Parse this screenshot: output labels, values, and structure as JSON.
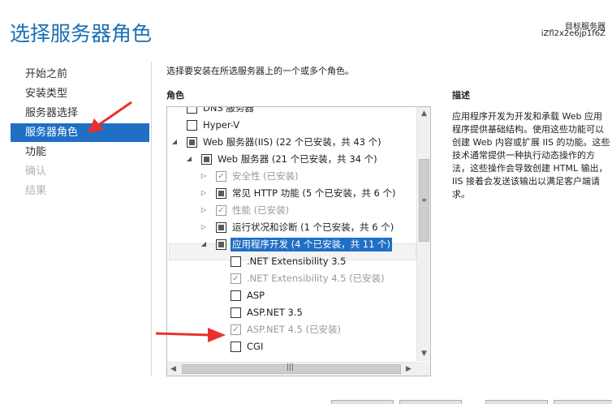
{
  "header": {
    "title": "选择服务器角色",
    "target_label": "目标服务器",
    "target_name": "iZfl2x2e6jp1f6Z"
  },
  "nav": {
    "items": [
      {
        "label": "开始之前",
        "state": "normal"
      },
      {
        "label": "安装类型",
        "state": "normal"
      },
      {
        "label": "服务器选择",
        "state": "normal"
      },
      {
        "label": "服务器角色",
        "state": "active"
      },
      {
        "label": "功能",
        "state": "normal"
      },
      {
        "label": "确认",
        "state": "disabled"
      },
      {
        "label": "结果",
        "state": "disabled"
      }
    ]
  },
  "main": {
    "instruction": "选择要安装在所选服务器上的一个或多个角色。",
    "roles_header": "角色",
    "description_header": "描述",
    "description": "应用程序开发为开发和承载 Web 应用程序提供基础结构。使用这些功能可以创建 Web 内容或扩展 IIS 的功能。这些技术通常提供一种执行动态操作的方法，这些操作会导致创建 HTML 输出，IIS 接着会发送该输出以满足客户端请求。"
  },
  "tree": {
    "rows": [
      {
        "label": "DNS 服务器",
        "state": "unchecked",
        "level": 0,
        "expander": "none"
      },
      {
        "label": "Hyper-V",
        "state": "unchecked",
        "level": 0,
        "expander": "none"
      },
      {
        "label": "Web 服务器(IIS) (22 个已安装，共 43 个)",
        "state": "partial",
        "level": 0,
        "expander": "expanded"
      },
      {
        "label": "Web 服务器 (21 个已安装，共 34 个)",
        "state": "partial",
        "level": 1,
        "expander": "expanded"
      },
      {
        "label": "安全性 (已安装)",
        "state": "checked-grey",
        "level": 2,
        "expander": "collapsed"
      },
      {
        "label": "常见 HTTP 功能 (5 个已安装，共 6 个)",
        "state": "partial",
        "level": 2,
        "expander": "collapsed"
      },
      {
        "label": "性能 (已安装)",
        "state": "checked-grey",
        "level": 2,
        "expander": "collapsed"
      },
      {
        "label": "运行状况和诊断 (1 个已安装，共 6 个)",
        "state": "partial",
        "level": 2,
        "expander": "collapsed"
      },
      {
        "label": "应用程序开发 (4 个已安装，共 11 个)",
        "state": "partial",
        "level": 2,
        "expander": "expanded",
        "selected": true
      },
      {
        "label": ".NET Extensibility 3.5",
        "state": "unchecked",
        "level": 3,
        "expander": "none"
      },
      {
        "label": ".NET Extensibility 4.5 (已安装)",
        "state": "checked-grey",
        "level": 3,
        "expander": "none"
      },
      {
        "label": "ASP",
        "state": "unchecked",
        "level": 3,
        "expander": "none"
      },
      {
        "label": "ASP.NET 3.5",
        "state": "unchecked",
        "level": 3,
        "expander": "none"
      },
      {
        "label": "ASP.NET 4.5 (已安装)",
        "state": "checked-grey",
        "level": 3,
        "expander": "none"
      },
      {
        "label": "CGI",
        "state": "unchecked",
        "level": 3,
        "expander": "none"
      }
    ]
  },
  "colors": {
    "title": "#1a6fb3",
    "selection": "#1f6fc5",
    "annotation_arrow": "#e8312f"
  },
  "icons": {
    "expanded": "triangle-expanded-icon",
    "collapsed": "triangle-collapsed-icon",
    "check": "check-icon"
  }
}
